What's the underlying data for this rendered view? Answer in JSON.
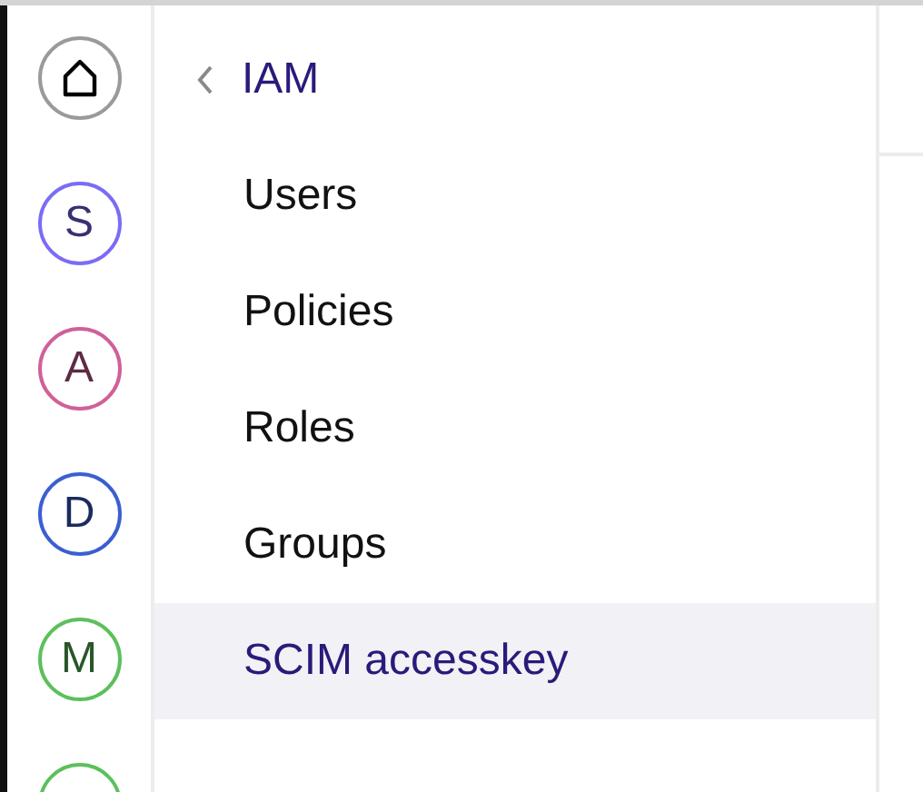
{
  "rail": [
    {
      "kind": "home",
      "color": "#9a9a9a"
    },
    {
      "kind": "letter",
      "label": "S",
      "color": "#7b6cf6"
    },
    {
      "kind": "letter",
      "label": "A",
      "color": "#d0609a"
    },
    {
      "kind": "letter",
      "label": "D",
      "color": "#3a5fd0"
    },
    {
      "kind": "letter",
      "label": "M",
      "color": "#5cc05c"
    },
    {
      "kind": "blank",
      "color": "#5cc05c"
    }
  ],
  "nav": {
    "back_title": "IAM",
    "items": [
      {
        "label": "Users",
        "selected": false
      },
      {
        "label": "Policies",
        "selected": false
      },
      {
        "label": "Roles",
        "selected": false
      },
      {
        "label": "Groups",
        "selected": false
      },
      {
        "label": "SCIM accesskey",
        "selected": true
      }
    ]
  }
}
